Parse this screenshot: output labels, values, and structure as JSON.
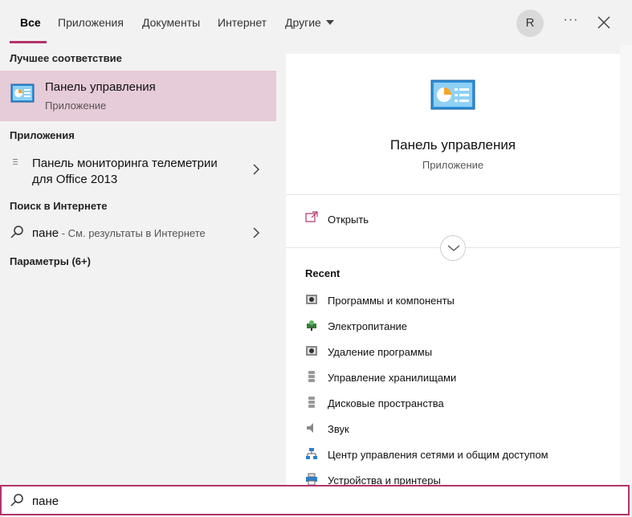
{
  "tabs": [
    {
      "label": "Все"
    },
    {
      "label": "Приложения"
    },
    {
      "label": "Документы"
    },
    {
      "label": "Интернет"
    },
    {
      "label": "Другие"
    }
  ],
  "user": {
    "initial": "R"
  },
  "more_label": "···",
  "left": {
    "best_match_title": "Лучшее соответствие",
    "best_match": {
      "name": "Панель управления",
      "type": "Приложение"
    },
    "apps_title": "Приложения",
    "apps": [
      {
        "name": "Панель мониторинга телеметрии для Office 2013"
      }
    ],
    "web_title": "Поиск в Интернете",
    "web": {
      "query": "пане",
      "hint": " - См. результаты в Интернете"
    },
    "settings_title": "Параметры (6+)"
  },
  "right": {
    "title": "Панель управления",
    "subtitle": "Приложение",
    "open_label": "Открыть",
    "recent_title": "Recent",
    "recent": [
      {
        "label": "Программы и компоненты",
        "icon": "programs-icon"
      },
      {
        "label": "Электропитание",
        "icon": "power-options-icon"
      },
      {
        "label": "Удаление программы",
        "icon": "uninstall-icon"
      },
      {
        "label": "Управление хранилищами",
        "icon": "storage-icon"
      },
      {
        "label": "Дисковые пространства",
        "icon": "storage-spaces-icon"
      },
      {
        "label": "Звук",
        "icon": "speaker-icon"
      },
      {
        "label": "Центр управления сетями и общим доступом",
        "icon": "network-icon"
      },
      {
        "label": "Устройства и принтеры",
        "icon": "printer-icon"
      }
    ]
  },
  "search": {
    "value": "пане"
  },
  "colors": {
    "accent": "#b4336a",
    "selection": "#e6cbd8"
  }
}
